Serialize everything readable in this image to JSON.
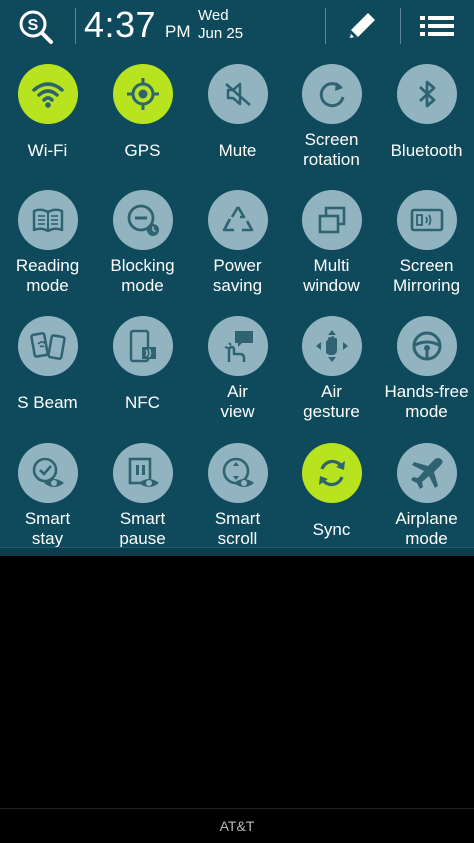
{
  "header": {
    "time": "4:37",
    "ampm": "PM",
    "day": "Wed",
    "date": "Jun 25",
    "search_icon": "s-finder-icon",
    "edit_icon": "pencil-icon",
    "settings_icon": "list-icon"
  },
  "colors": {
    "panel": "#0f4a5c",
    "tile_off": "#92b4c1",
    "tile_on": "#b7e41f"
  },
  "toggles": [
    {
      "line1": "Wi-Fi",
      "line2": "",
      "state": "on",
      "icon": "wifi-icon"
    },
    {
      "line1": "GPS",
      "line2": "",
      "state": "on",
      "icon": "gps-icon"
    },
    {
      "line1": "Mute",
      "line2": "",
      "state": "off",
      "icon": "mute-icon"
    },
    {
      "line1": "Screen",
      "line2": "rotation",
      "state": "off",
      "icon": "rotation-icon"
    },
    {
      "line1": "Bluetooth",
      "line2": "",
      "state": "off",
      "icon": "bluetooth-icon"
    },
    {
      "line1": "Reading",
      "line2": "mode",
      "state": "off",
      "icon": "book-icon"
    },
    {
      "line1": "Blocking",
      "line2": "mode",
      "state": "off",
      "icon": "blocking-icon"
    },
    {
      "line1": "Power",
      "line2": "saving",
      "state": "off",
      "icon": "recycle-icon"
    },
    {
      "line1": "Multi",
      "line2": "window",
      "state": "off",
      "icon": "multi-window-icon"
    },
    {
      "line1": "Screen",
      "line2": "Mirroring",
      "state": "off",
      "icon": "mirroring-icon"
    },
    {
      "line1": "S Beam",
      "line2": "",
      "state": "off",
      "icon": "s-beam-icon"
    },
    {
      "line1": "NFC",
      "line2": "",
      "state": "off",
      "icon": "nfc-icon"
    },
    {
      "line1": "Air",
      "line2": "view",
      "state": "off",
      "icon": "air-view-icon"
    },
    {
      "line1": "Air",
      "line2": "gesture",
      "state": "off",
      "icon": "air-gesture-icon"
    },
    {
      "line1": "Hands-free",
      "line2": "mode",
      "state": "off",
      "icon": "steering-wheel-icon"
    },
    {
      "line1": "Smart",
      "line2": "stay",
      "state": "off",
      "icon": "smart-stay-icon"
    },
    {
      "line1": "Smart",
      "line2": "pause",
      "state": "off",
      "icon": "smart-pause-icon"
    },
    {
      "line1": "Smart",
      "line2": "scroll",
      "state": "off",
      "icon": "smart-scroll-icon"
    },
    {
      "line1": "Sync",
      "line2": "",
      "state": "on",
      "icon": "sync-icon"
    },
    {
      "line1": "Airplane",
      "line2": "mode",
      "state": "off",
      "icon": "airplane-icon"
    }
  ],
  "footer": {
    "carrier": "AT&T"
  }
}
